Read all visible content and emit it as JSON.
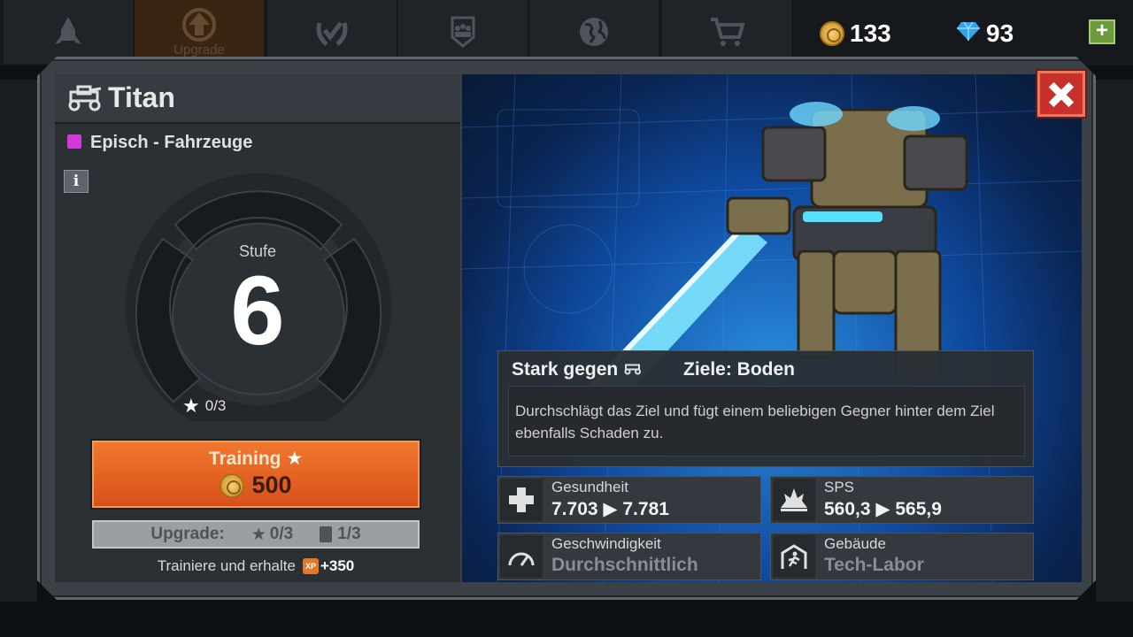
{
  "nav": {
    "tabs": [
      {
        "icon": "rocket-icon",
        "label": ""
      },
      {
        "icon": "upgrade-arrow-icon",
        "label": "Upgrade"
      },
      {
        "icon": "wreath-check-icon",
        "label": ""
      },
      {
        "icon": "group-icon",
        "label": ""
      },
      {
        "icon": "globe-icon",
        "label": ""
      },
      {
        "icon": "cart-icon",
        "label": ""
      }
    ],
    "active_tab": "Upgrade"
  },
  "resources": {
    "gold": "133",
    "diamonds": "93",
    "add_label": "+"
  },
  "unit": {
    "name": "Titan",
    "category": "Episch - Fahrzeuge",
    "category_color": "#d03ad8",
    "info_label": "i",
    "level_label": "Stufe",
    "level": "6",
    "stars": "0/3"
  },
  "training": {
    "label": "Training",
    "cost": "500"
  },
  "upgrade": {
    "label": "Upgrade:",
    "stars": "0/3",
    "cards": "1/3"
  },
  "xp": {
    "text": "Trainiere und erhalte",
    "badge": "XP",
    "amount": "+350"
  },
  "details": {
    "strong_against": "Stark gegen",
    "targets": "Ziele: Boden",
    "description": "Durchschlägt das Ziel und fügt einem beliebigen Gegner hinter dem Ziel ebenfalls Schaden zu."
  },
  "stats": [
    {
      "label": "Gesundheit",
      "value": "7.703 ▶ 7.781",
      "icon": "health-cross-icon"
    },
    {
      "label": "SPS",
      "value": "560,3 ▶ 565,9",
      "icon": "damage-burst-icon"
    },
    {
      "label": "Geschwindigkeit",
      "value": "Durchschnittlich",
      "icon": "speedometer-icon"
    },
    {
      "label": "Gebäude",
      "value": "Tech-Labor",
      "icon": "building-runner-icon"
    }
  ],
  "colors": {
    "training_button": "#e8632a",
    "close_button": "#c9302a",
    "accent_gold": "#f2c14e"
  }
}
